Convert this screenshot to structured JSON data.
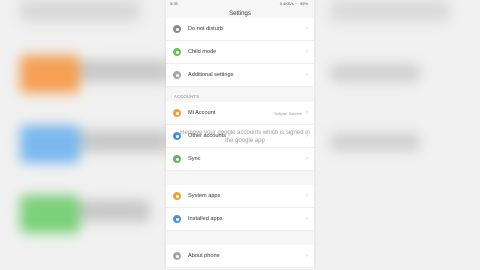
{
  "status_bar": {
    "time": "5:35",
    "indicators": "0.4KB/s ··· 95%"
  },
  "screen_title": "Settings",
  "rows_top": [
    {
      "label": "Do not disturb",
      "icon": "moon-icon",
      "color": "#8c8c8c"
    },
    {
      "label": "Child mode",
      "icon": "child-icon",
      "color": "#6cbf5a"
    },
    {
      "label": "Additional settings",
      "icon": "more-icon",
      "color": "#a6a6a6"
    }
  ],
  "accounts_section": "ACCOUNTS",
  "rows_accounts": [
    {
      "label": "Mi Account",
      "value": "Sufiyan Saleem",
      "icon": "mi-account-icon",
      "color": "#f0a030"
    },
    {
      "label": "Other accounts",
      "value": "",
      "icon": "accounts-icon",
      "color": "#4a90d9"
    },
    {
      "label": "Sync",
      "value": "",
      "icon": "sync-icon",
      "color": "#5cb85c"
    }
  ],
  "rows_apps": [
    {
      "label": "System apps",
      "icon": "system-apps-icon",
      "color": "#f0a030"
    },
    {
      "label": "Installed apps",
      "icon": "installed-apps-icon",
      "color": "#4a90d9"
    }
  ],
  "rows_bottom": [
    {
      "label": "About phone",
      "icon": "about-icon",
      "color": "#a6a6a6"
    }
  ],
  "overlay_text": "Remove your google accounts which is signed in the google app"
}
